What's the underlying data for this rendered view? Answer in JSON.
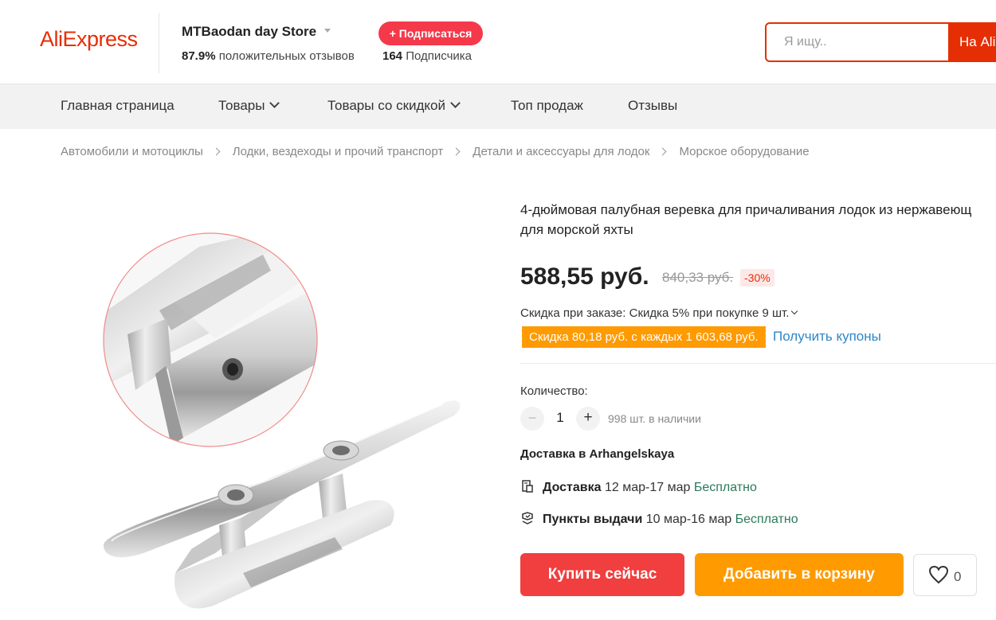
{
  "brand": {
    "logo_text": "AliExpress",
    "accent": "#e62e04"
  },
  "store": {
    "name": "MTBaodan day Store",
    "rating_value": "87.9%",
    "rating_text": "положительных отзывов",
    "follow_label": "+ Подписаться",
    "followers_count": "164",
    "followers_text": "Подписчика"
  },
  "search": {
    "placeholder": "Я ищу..",
    "button_label": "На Ali"
  },
  "nav": {
    "items": [
      {
        "label": "Главная страница",
        "dropdown": false
      },
      {
        "label": "Товары",
        "dropdown": true
      },
      {
        "label": "Товары со скидкой",
        "dropdown": true
      },
      {
        "label": "Топ продаж",
        "dropdown": false
      },
      {
        "label": "Отзывы",
        "dropdown": false
      }
    ]
  },
  "breadcrumb": [
    "Автомобили и мотоциклы",
    "Лодки, вездеходы и прочий транспорт",
    "Детали и аксессуары для лодок",
    "Морское оборудование"
  ],
  "product": {
    "title_line1": "4-дюймовая палубная веревка для причаливания лодок из нержавеющ",
    "title_line2": "для морской яхты",
    "price": "588,55 руб.",
    "old_price": "840,33 руб.",
    "discount": "-30%",
    "order_discount": "Скидка при заказе: Скидка 5% при покупке 9 шт.",
    "coupon_text": "Скидка 80,18 руб. с каждых 1 603,68 руб.",
    "get_coupons_label": "Получить купоны",
    "quantity_label": "Количество:",
    "quantity_value": "1",
    "stock_text": "998 шт. в наличии",
    "image_icon": "boat-cleat-image"
  },
  "shipping": {
    "ship_to": "Доставка в Arhangelskaya",
    "rows": [
      {
        "icon": "delivery-icon",
        "label": "Доставка",
        "dates": "12 мар-17 мар",
        "price": "Бесплатно"
      },
      {
        "icon": "pickup-point-icon",
        "label": "Пункты выдачи",
        "dates": "10 мар-16 мар",
        "price": "Бесплатно"
      }
    ]
  },
  "actions": {
    "buy_now_label": "Купить сейчас",
    "add_to_cart_label": "Добавить в корзину",
    "wishlist_count": "0"
  },
  "colors": {
    "buy_now": "#f13e3e",
    "add_to_cart": "#ff9a00",
    "link": "#2e87c8",
    "free_shipping": "#2a7a5a"
  }
}
